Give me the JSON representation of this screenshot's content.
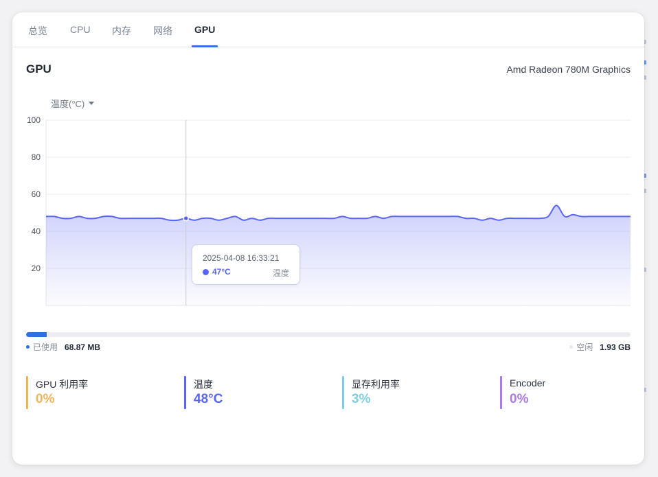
{
  "tabs": [
    {
      "label": "总览",
      "active": false
    },
    {
      "label": "CPU",
      "active": false
    },
    {
      "label": "内存",
      "active": false
    },
    {
      "label": "网络",
      "active": false
    },
    {
      "label": "GPU",
      "active": true
    }
  ],
  "gpu": {
    "title": "GPU",
    "model": "Amd Radeon 780M Graphics"
  },
  "metric_selector": {
    "selected": "温度(°C)",
    "icon": "caret-down-icon"
  },
  "chart_data": {
    "type": "area",
    "title": "",
    "xlabel": "",
    "ylabel": "温度(°C)",
    "ylim": [
      0,
      100
    ],
    "yticks": [
      20,
      40,
      60,
      80,
      100
    ],
    "grid": true,
    "color": "#5865f2",
    "series": [
      {
        "name": "温度",
        "values": [
          48,
          48,
          47,
          47,
          48,
          47,
          47,
          48,
          48,
          47,
          47,
          47,
          47,
          47,
          47,
          46,
          46,
          47,
          46,
          47,
          47,
          46,
          47,
          48,
          46,
          47,
          46,
          47,
          47,
          47,
          47,
          47,
          47,
          47,
          47,
          47,
          48,
          47,
          47,
          47,
          48,
          47,
          48,
          48,
          48,
          48,
          48,
          48,
          48,
          48,
          48,
          47,
          47,
          46,
          47,
          46,
          47,
          47,
          47,
          47,
          47,
          48,
          54,
          48,
          49,
          48,
          48,
          48,
          48,
          48,
          48,
          48
        ]
      }
    ],
    "highlight_index": 17,
    "tooltip": {
      "time": "2025-04-08 16:33:21",
      "value": "47°C",
      "series_name": "温度"
    }
  },
  "memory": {
    "used_label": "已使用",
    "used_value": "68.87 MB",
    "free_label": "空闲",
    "free_value": "1.93 GB",
    "used_fraction": 0.034,
    "used_color": "#2f6fe0"
  },
  "stats": [
    {
      "label": "GPU 利用率",
      "value": "0%",
      "color": "#f0b45c"
    },
    {
      "label": "温度",
      "value": "48°C",
      "color": "#5865f2"
    },
    {
      "label": "显存利用率",
      "value": "3%",
      "color": "#7ecde0"
    },
    {
      "label": "Encoder",
      "value": "0%",
      "color": "#a97ae8"
    }
  ]
}
